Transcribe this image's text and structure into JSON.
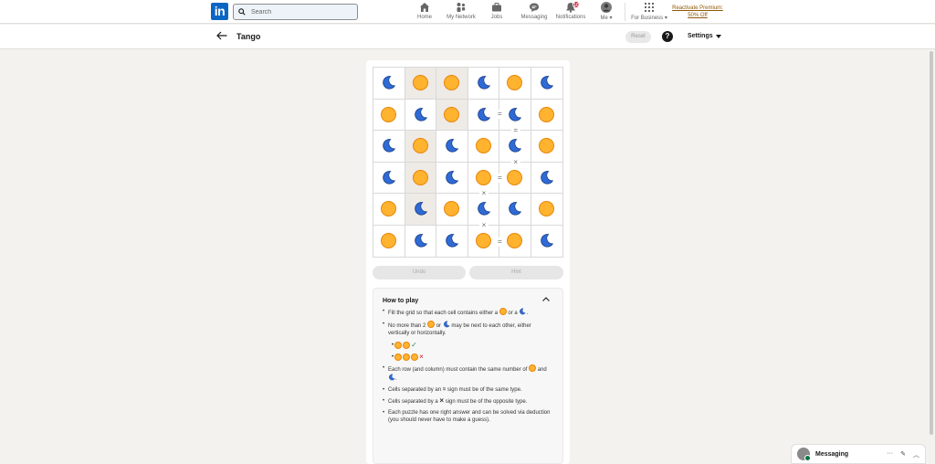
{
  "nav": {
    "logo": "in",
    "search_placeholder": "Search",
    "items": [
      {
        "label": "Home",
        "icon": "home-icon"
      },
      {
        "label": "My Network",
        "icon": "network-icon"
      },
      {
        "label": "Jobs",
        "icon": "jobs-icon"
      },
      {
        "label": "Messaging",
        "icon": "messaging-icon"
      },
      {
        "label": "Notifications",
        "icon": "bell-icon",
        "badge": "10"
      },
      {
        "label": "Me ▾",
        "icon": "avatar"
      }
    ],
    "business": "For Business ▾",
    "premium_line1": "Reactivate Premium:",
    "premium_line2": "50% Off"
  },
  "header": {
    "title": "Tango",
    "reset": "Reset",
    "help": "?",
    "settings": "Settings"
  },
  "board": {
    "rows": [
      [
        "moon",
        "sun",
        "sun",
        "moon",
        "sun",
        "moon"
      ],
      [
        "sun",
        "moon",
        "sun",
        "moon",
        "moon",
        "sun"
      ],
      [
        "moon",
        "sun",
        "moon",
        "sun",
        "moon",
        "sun"
      ],
      [
        "moon",
        "sun",
        "moon",
        "sun",
        "sun",
        "moon"
      ],
      [
        "sun",
        "moon",
        "sun",
        "moon",
        "moon",
        "sun"
      ],
      [
        "sun",
        "moon",
        "moon",
        "sun",
        "sun",
        "moon"
      ]
    ],
    "locked": [
      [
        0,
        1
      ],
      [
        0,
        2
      ],
      [
        1,
        2
      ],
      [
        2,
        1
      ],
      [
        3,
        1
      ],
      [
        4,
        1
      ]
    ],
    "signs": {
      "equal": "=",
      "cross": "×"
    }
  },
  "buttons": {
    "undo": "Undo",
    "hint": "Hint"
  },
  "howto": {
    "title": "How to play",
    "rule1_a": "Fill the grid so that each cell contains either a",
    "rule1_b": "or a",
    "rule2_a": "No more than 2",
    "rule2_b": "or",
    "rule2_c": "may be next to each other, either vertically or horizontally.",
    "check": "✓",
    "cross": "×",
    "rule3_a": "Each row (and column) must contain the same number of",
    "rule3_b": "and",
    "rule4_a": "Cells separated by an",
    "rule4_sign": "=",
    "rule4_b": "sign must be of the same type.",
    "rule5_a": "Cells separated by a",
    "rule5_sign": "×",
    "rule5_b": "sign must be of the opposite type.",
    "rule6": "Each puzzle has one right answer and can be solved via deduction (you should never have to make a guess)."
  },
  "messaging": {
    "label": "Messaging",
    "more": "···",
    "compose": "✎",
    "collapse": "︿"
  },
  "colors": {
    "sun_fill": "#ffb32e",
    "moon_fill": "#2f6bd6",
    "brand": "#0a66c2"
  }
}
